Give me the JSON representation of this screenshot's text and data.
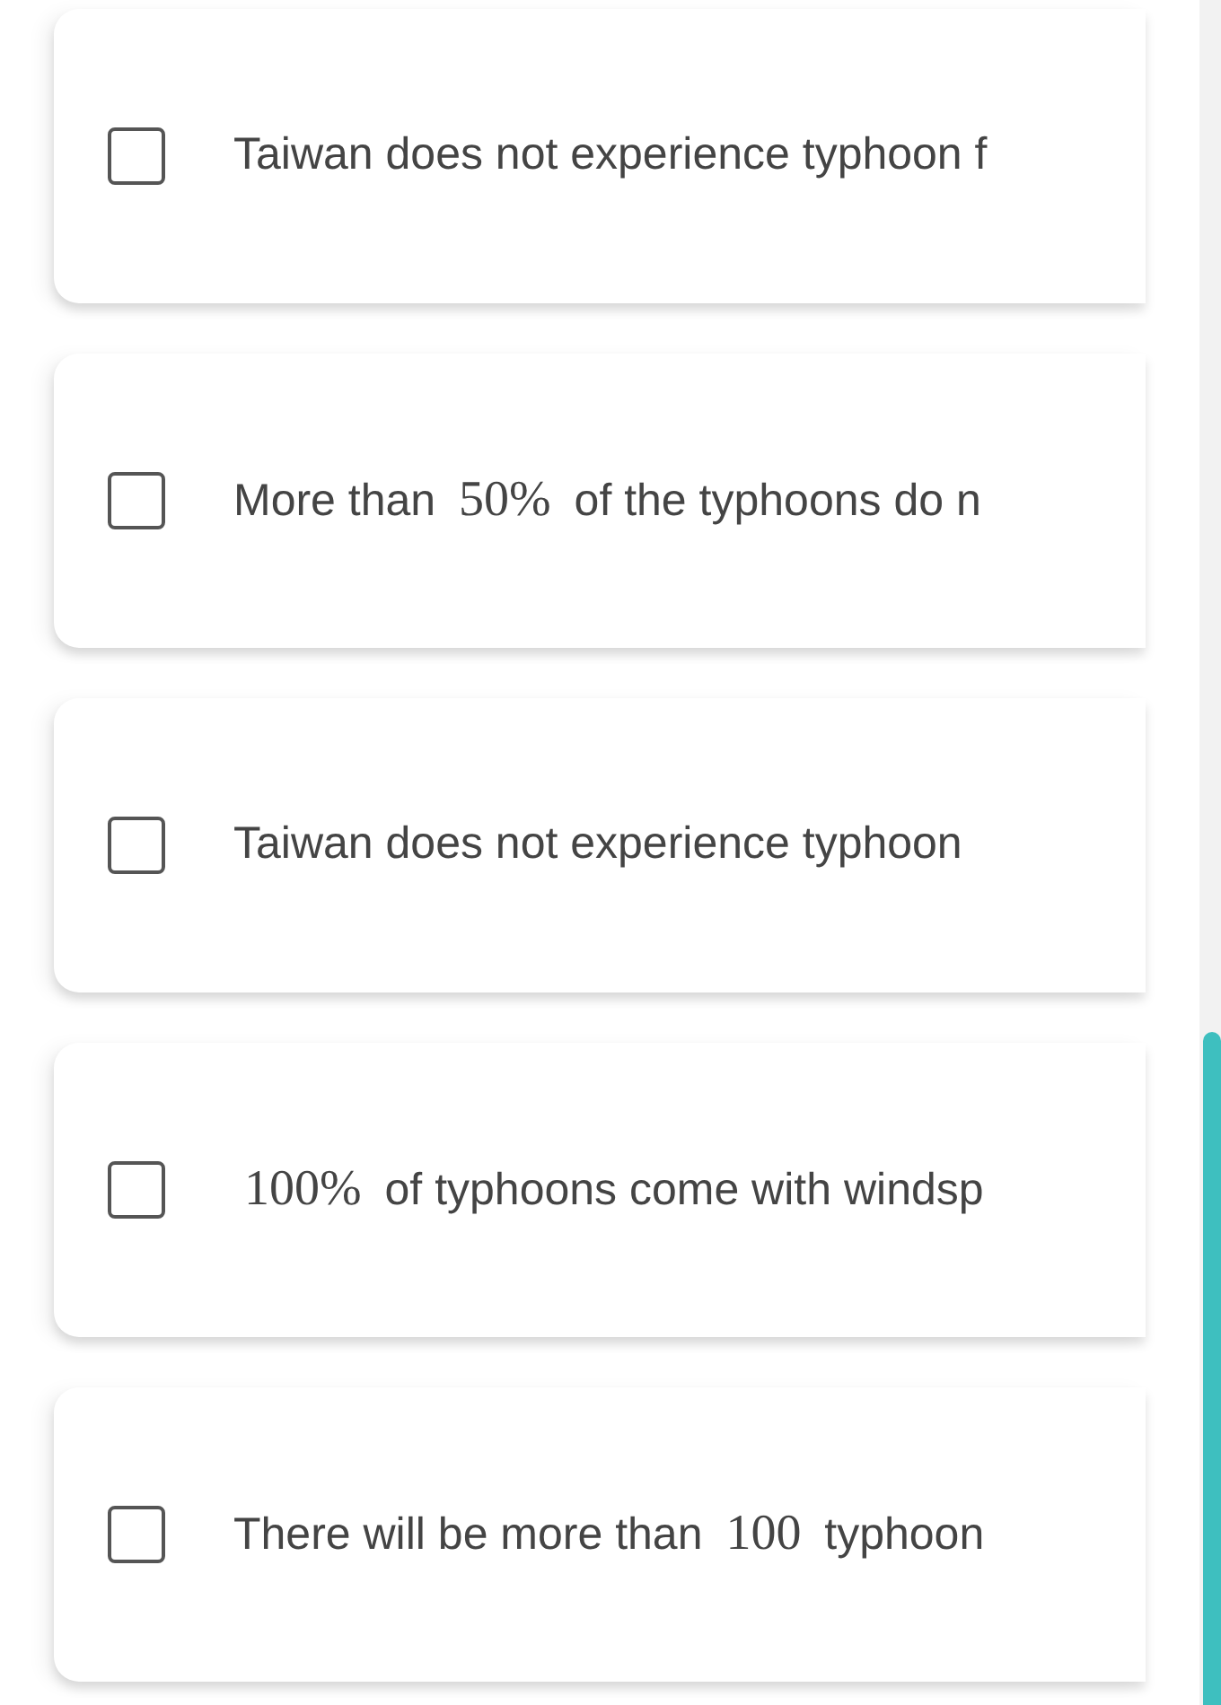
{
  "options": [
    {
      "checked": false,
      "segments": [
        {
          "kind": "text",
          "text": "Taiwan does not experience typhoon f"
        }
      ]
    },
    {
      "checked": false,
      "segments": [
        {
          "kind": "text",
          "text": "More than "
        },
        {
          "kind": "math",
          "text": "50%"
        },
        {
          "kind": "text",
          "text": " of the typhoons do n"
        }
      ]
    },
    {
      "checked": false,
      "segments": [
        {
          "kind": "text",
          "text": "Taiwan does not experience typhoon"
        }
      ]
    },
    {
      "checked": false,
      "segments": [
        {
          "kind": "math",
          "text": "100%"
        },
        {
          "kind": "text",
          "text": " of typhoons come with windsp"
        }
      ]
    },
    {
      "checked": false,
      "segments": [
        {
          "kind": "text",
          "text": "There will be more than "
        },
        {
          "kind": "math",
          "text": "100"
        },
        {
          "kind": "text",
          "text": " typhoon"
        }
      ]
    }
  ]
}
